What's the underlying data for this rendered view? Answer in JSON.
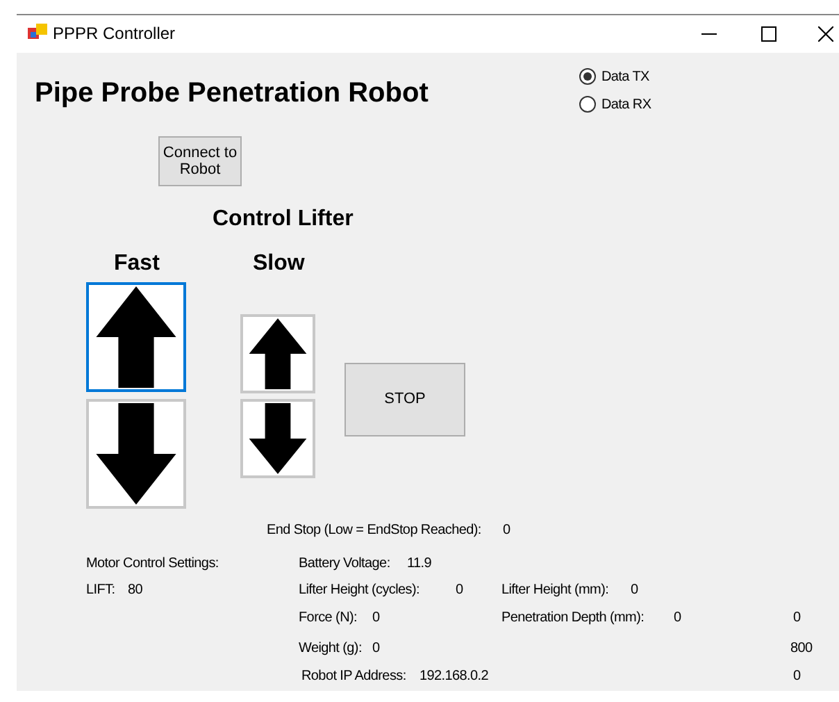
{
  "window": {
    "title": "PPPR Controller"
  },
  "heading": "Pipe Probe Penetration Robot",
  "radios": [
    {
      "label": "Data TX",
      "selected": true
    },
    {
      "label": "Data RX",
      "selected": false
    }
  ],
  "connect_button": "Connect to Robot",
  "lifter": {
    "title": "Control Lifter",
    "speeds": [
      {
        "label": "Fast",
        "buttons": [
          {
            "kind": "up",
            "focused": true
          },
          {
            "kind": "down",
            "focused": false
          }
        ]
      },
      {
        "label": "Slow",
        "buttons": [
          {
            "kind": "up",
            "focused": false
          },
          {
            "kind": "down",
            "focused": false
          }
        ]
      }
    ],
    "stop_button": "STOP"
  },
  "end_stop": {
    "label": "End Stop (Low = EndStop Reached):",
    "value": "0"
  },
  "motor_settings": {
    "title": "Motor Control Settings:",
    "label": "LIFT:",
    "value": "80"
  },
  "readings": [
    {
      "label": "Battery Voltage:",
      "value": "11.9"
    },
    {
      "label": "Lifter Height (cycles):",
      "value": "0"
    },
    {
      "label": "Lifter Height (mm):",
      "value": "0"
    },
    {
      "label": "Force (N):",
      "value": "0"
    },
    {
      "label": "Penetration Depth (mm):",
      "value": "0"
    },
    {
      "label": "Weight (g):",
      "value": "0"
    },
    {
      "label": "Robot IP Address:",
      "value": "192.168.0.2"
    }
  ],
  "right_values": [
    "0",
    "800",
    "0"
  ]
}
